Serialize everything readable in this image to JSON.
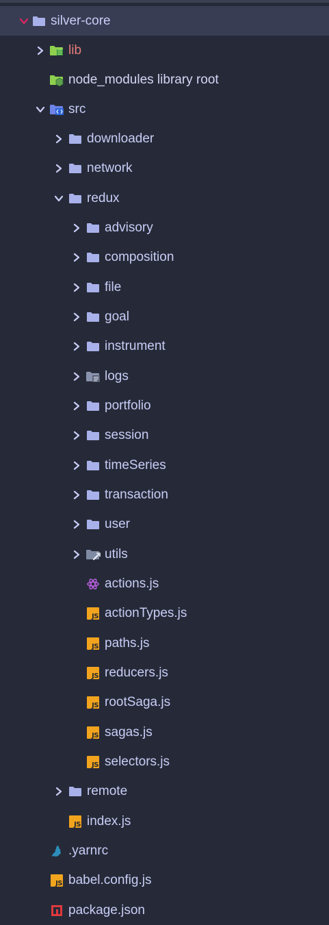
{
  "colors": {
    "background": "#262a38",
    "selected_row": "#383d54",
    "folder": "#a9b1ea",
    "text": "#c9cdf6",
    "lib_text": "#e87c7c",
    "chevron_root": "#e0245e",
    "js_badge": "#f2a41e",
    "npm_red": "#e0383e",
    "redux_purple": "#b05cd6"
  },
  "tree": {
    "root": {
      "label": "silver-core",
      "icon": "folder-icon"
    },
    "items": [
      {
        "label": "lib",
        "icon": "lib-folder-icon"
      },
      {
        "label": "node_modules  library root",
        "icon": "node-modules-icon"
      },
      {
        "label": "src",
        "icon": "src-folder-icon"
      },
      {
        "label": "downloader",
        "icon": "folder-icon"
      },
      {
        "label": "network",
        "icon": "folder-icon"
      },
      {
        "label": "redux",
        "icon": "folder-icon"
      },
      {
        "label": "advisory",
        "icon": "folder-icon"
      },
      {
        "label": "composition",
        "icon": "folder-icon"
      },
      {
        "label": "file",
        "icon": "folder-icon"
      },
      {
        "label": "goal",
        "icon": "folder-icon"
      },
      {
        "label": "instrument",
        "icon": "folder-icon"
      },
      {
        "label": "logs",
        "icon": "logs-folder-icon"
      },
      {
        "label": "portfolio",
        "icon": "folder-icon"
      },
      {
        "label": "session",
        "icon": "folder-icon"
      },
      {
        "label": "timeSeries",
        "icon": "folder-icon"
      },
      {
        "label": "transaction",
        "icon": "folder-icon"
      },
      {
        "label": "user",
        "icon": "folder-icon"
      },
      {
        "label": "utils",
        "icon": "utils-folder-icon"
      },
      {
        "label": "actions.js",
        "icon": "redux-icon"
      },
      {
        "label": "actionTypes.js",
        "icon": "js-file-icon"
      },
      {
        "label": "paths.js",
        "icon": "js-file-icon"
      },
      {
        "label": "reducers.js",
        "icon": "js-file-icon"
      },
      {
        "label": "rootSaga.js",
        "icon": "js-file-icon"
      },
      {
        "label": "sagas.js",
        "icon": "js-file-icon"
      },
      {
        "label": "selectors.js",
        "icon": "js-file-icon"
      },
      {
        "label": "remote",
        "icon": "folder-icon"
      },
      {
        "label": "index.js",
        "icon": "js-file-icon"
      },
      {
        "label": ".yarnrc",
        "icon": "yarn-icon"
      },
      {
        "label": "babel.config.js",
        "icon": "js-file-icon"
      },
      {
        "label": "package.json",
        "icon": "npm-icon"
      }
    ]
  }
}
